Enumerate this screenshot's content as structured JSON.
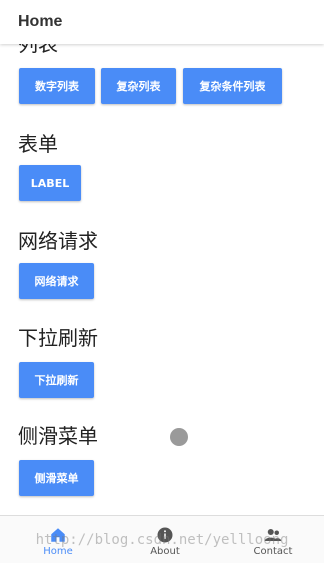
{
  "header": {
    "title": "Home"
  },
  "sections": [
    {
      "title": "列表",
      "buttons": [
        "数字列表",
        "复杂列表",
        "复杂条件列表"
      ]
    },
    {
      "title": "表单",
      "buttons": [
        "LABEL"
      ]
    },
    {
      "title": "网络请求",
      "buttons": [
        "网络请求"
      ]
    },
    {
      "title": "下拉刷新",
      "buttons": [
        "下拉刷新"
      ]
    },
    {
      "title": "侧滑菜单",
      "buttons": [
        "侧滑菜单"
      ]
    }
  ],
  "bottom_nav": {
    "items": [
      {
        "label": "Home",
        "icon": "home-icon",
        "active": true
      },
      {
        "label": "About",
        "icon": "info-icon",
        "active": false
      },
      {
        "label": "Contact",
        "icon": "contact-icon",
        "active": false
      }
    ]
  },
  "watermark": "http://blog.csdn.net/yellloong",
  "colors": {
    "primary": "#4a8cf7",
    "text": "#222222",
    "inactive": "#555555"
  }
}
